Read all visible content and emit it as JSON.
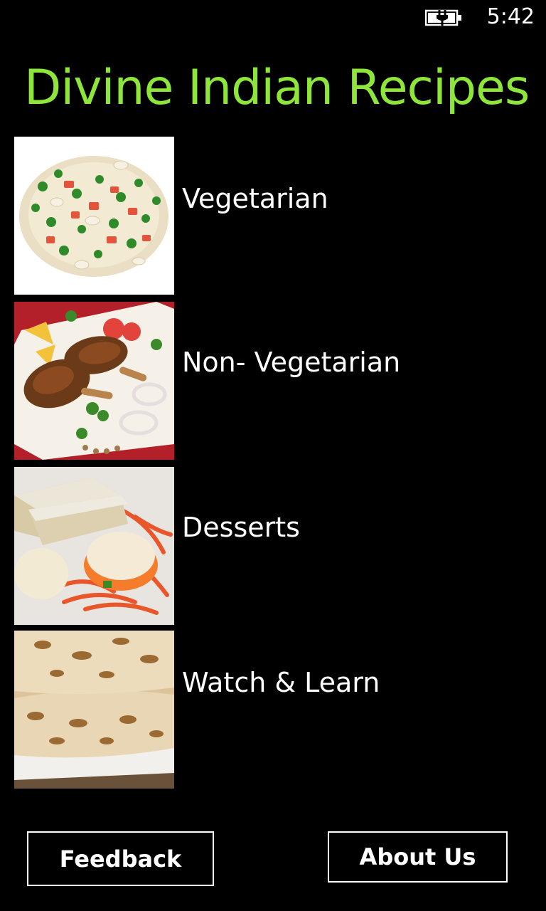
{
  "status_bar": {
    "battery_icon": "battery-charging-icon",
    "time": "5:42"
  },
  "app": {
    "title": "Divine Indian Recipes",
    "accent_color": "#8fe63a"
  },
  "categories": [
    {
      "label": "Vegetarian",
      "image": "vegetable-pulao-image"
    },
    {
      "label": "Non- Vegetarian",
      "image": "roast-chicken-legs-image"
    },
    {
      "label": "Desserts",
      "image": "indian-sweets-image"
    },
    {
      "label": "Watch & Learn",
      "image": "naan-bread-image"
    }
  ],
  "footer": {
    "feedback_label": "Feedback",
    "about_label": "About Us"
  }
}
